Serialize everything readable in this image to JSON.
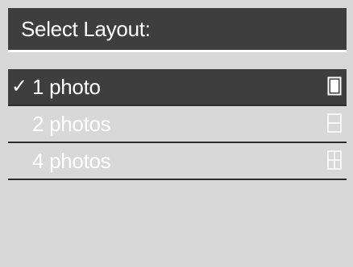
{
  "header": {
    "title": "Select Layout:"
  },
  "menu": {
    "check_mark": "✓",
    "items": [
      {
        "label": "1 photo",
        "icon": "single-photo-layout-icon",
        "selected": true
      },
      {
        "label": "2 photos",
        "icon": "two-photo-layout-icon",
        "selected": false
      },
      {
        "label": "4 photos",
        "icon": "four-photo-layout-icon",
        "selected": false
      }
    ]
  },
  "colors": {
    "header_bg": "#3e3e3e",
    "selected_bg": "#3e3e3e",
    "list_bg": "#d8d8d8",
    "text": "#ffffff"
  }
}
